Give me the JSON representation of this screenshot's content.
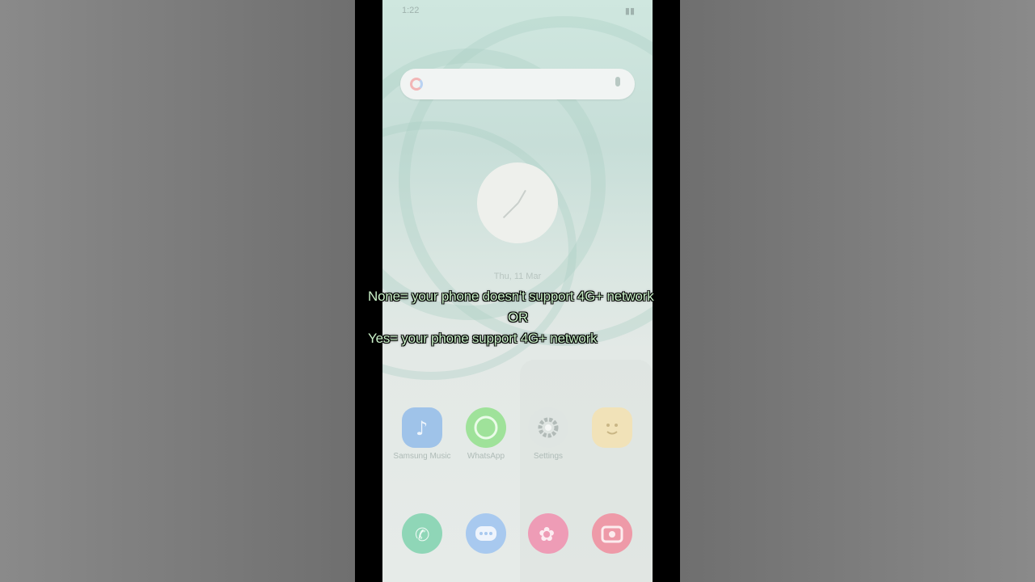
{
  "status_bar": {
    "time": "1:22"
  },
  "home_screen": {
    "date": "Thu, 11 Mar"
  },
  "apps_row": [
    {
      "label": "Samsung Music",
      "icon": "music-note-icon",
      "color": "#9fc3e9"
    },
    {
      "label": "WhatsApp",
      "icon": "whatsapp-icon",
      "color": "#9fe29a"
    },
    {
      "label": "Settings",
      "icon": "gear-icon",
      "color": "#dfe5e2"
    },
    {
      "label": "",
      "icon": "emoji-app-icon",
      "color": "#f1e2b8"
    }
  ],
  "dock": [
    {
      "icon": "phone-icon",
      "color": "#8fd6b7"
    },
    {
      "icon": "messages-icon",
      "color": "#a8c9ef"
    },
    {
      "icon": "gallery-icon",
      "color": "#ee9cb6"
    },
    {
      "icon": "camera-icon",
      "color": "#ee9aa8"
    }
  ],
  "caption": {
    "line1": "None= your phone doesn't support 4G+ network",
    "line2": "OR",
    "line3": "Yes= your phone support 4G+ network"
  }
}
